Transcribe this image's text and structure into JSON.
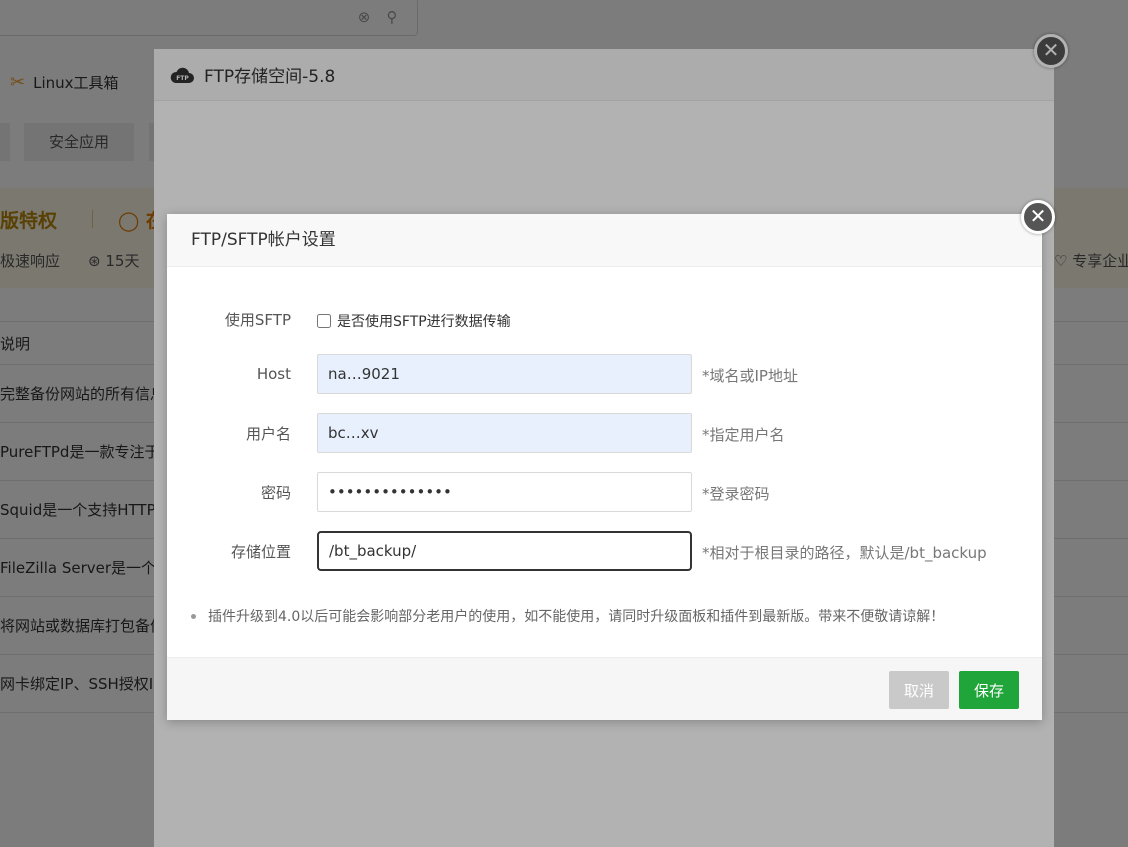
{
  "background": {
    "linux_toolbox": "Linux工具箱",
    "tab_security": "安全应用",
    "banner_title": "版特权",
    "banner_title2": "在",
    "feature_fast": "极速响应",
    "feature_refund": "15天",
    "feature_exclusive": "专享企业",
    "table_header": "说明",
    "rows": [
      "完整备份网站的所有信息",
      "PureFTPd是一款专注于",
      "Squid是一个支持HTTP，",
      "FileZilla Server是一个小",
      "将网站或数据库打包备份",
      "网卡绑定IP、SSH授权IP"
    ]
  },
  "panel": {
    "title": "FTP存储空间-5.8",
    "close_label": "✕"
  },
  "dialog": {
    "title": "FTP/SFTP帐户设置",
    "close_label": "✕",
    "sftp_label": "使用SFTP",
    "sftp_checkbox_label": "是否使用SFTP进行数据传输",
    "host_label": "Host",
    "host_value": "na…9021",
    "host_hint": "*域名或IP地址",
    "user_label": "用户名",
    "user_value": "bc…xv",
    "user_hint": "*指定用户名",
    "password_label": "密码",
    "password_value": "••••••••••••••",
    "password_hint": "*登录密码",
    "path_label": "存储位置",
    "path_value": "/bt_backup/",
    "path_hint": "*相对于根目录的路径，默认是/bt_backup",
    "notice": "插件升级到4.0以后可能会影响部分老用户的使用，如不能使用，请同时升级面板和插件到最新版。带来不便敬请谅解！",
    "cancel_label": "取消",
    "save_label": "保存"
  },
  "colors": {
    "save_button": "#20a53a",
    "cancel_button": "#c9c9c9",
    "autofill_bg": "#e8f0fe"
  }
}
